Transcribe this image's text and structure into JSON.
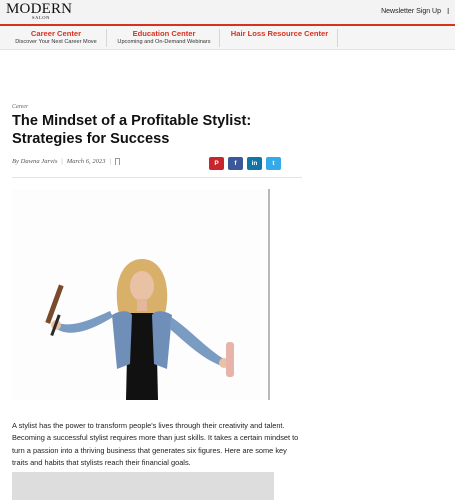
{
  "header": {
    "logo_main": "MODERN",
    "logo_sub": "SALON",
    "newsletter_label": "Newsletter Sign Up",
    "menu_glyph": "l"
  },
  "centers": [
    {
      "title": "Career Center",
      "subtitle": "Discover Your Next Career Move"
    },
    {
      "title": "Education Center",
      "subtitle": "Upcoming and On-Demand Webinars"
    },
    {
      "title": "Hair Loss Resource Center",
      "subtitle": ""
    }
  ],
  "article": {
    "category": "Career",
    "title": "The Mindset of a Profitable Stylist: Strategies for Success",
    "author": "By Dawna Jarvis",
    "date": "March 6, 2023",
    "body": "A stylist has the power to transform people's lives through their creativity and talent. Becoming a successful stylist requires more than just skills. It takes a certain mindset to turn a passion into a thriving business that generates six figures. Here are some key traits and habits that stylists reach their financial goals."
  },
  "share": {
    "pinterest": "P",
    "facebook": "f",
    "linkedin": "in",
    "twitter": "t"
  },
  "colors": {
    "accent": "#d8321f",
    "pinterest": "#c9252d",
    "facebook": "#3b5998",
    "linkedin": "#0e76a8",
    "twitter": "#35aae8"
  },
  "icons": [
    "menu-icon",
    "bookmark-icon",
    "pinterest-icon",
    "facebook-icon",
    "linkedin-icon",
    "twitter-icon"
  ]
}
